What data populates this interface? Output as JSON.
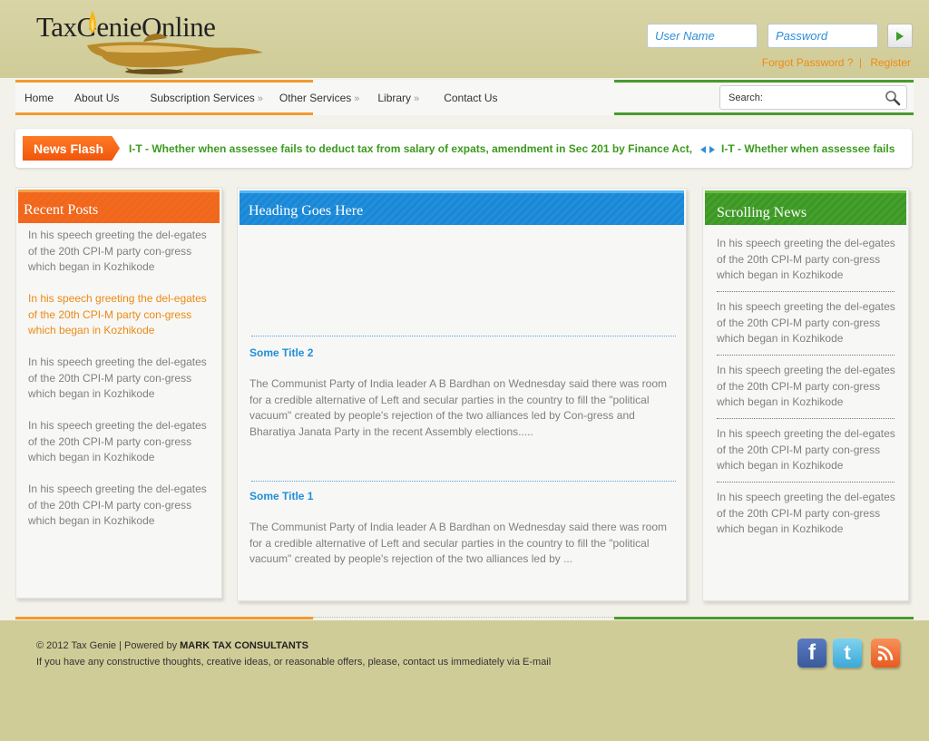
{
  "header": {
    "logo_text": "TaxGenieOnline",
    "user_placeholder": "User Name",
    "pass_placeholder": "Password",
    "forgot_link": "Forgot Password ?",
    "separator": "|",
    "register_link": "Register"
  },
  "nav": {
    "items": [
      {
        "label": "Home",
        "has_submenu": false
      },
      {
        "label": "About Us",
        "has_submenu": false
      },
      {
        "label": "Subscription Services",
        "has_submenu": true
      },
      {
        "label": "Other Services",
        "has_submenu": true
      },
      {
        "label": "Library",
        "has_submenu": true
      },
      {
        "label": "Contact Us",
        "has_submenu": false
      }
    ],
    "submenu_glyph": "»",
    "search_placeholder": "Search:"
  },
  "newsflash": {
    "badge": "News Flash",
    "text_1": "I-T - Whether when assessee fails to deduct tax from salary of expats, amendment in Sec 201 by Finance Act,",
    "text_2": "I-T - Whether when assessee fails"
  },
  "recent_posts": {
    "title": "Recent Posts",
    "items": [
      "In his speech greeting the del-egates of the 20th CPI-M party con-gress which began in Kozhikode",
      "In his speech greeting the del-egates of the 20th CPI-M party con-gress which began in Kozhikode",
      "In his speech greeting the del-egates of the 20th CPI-M party con-gress which began in Kozhikode",
      "In his speech greeting the del-egates of the 20th CPI-M party con-gress which began in Kozhikode",
      "In his speech greeting the del-egates of the 20th CPI-M party con-gress which began in Kozhikode"
    ]
  },
  "main": {
    "title": "Heading Goes Here",
    "items": [
      {
        "title": "Some Title 2",
        "body": "The Communist Party of India leader A B Bardhan on Wednesday said there was room for a credible alternative of Left and secular parties in the country to fill the \"political vacuum\" created by people's rejection of the two alliances led by Con-gress and Bharatiya Janata Party in the recent Assembly elections....."
      },
      {
        "title": "Some Title 1",
        "body": "The Communist Party of India leader A B Bardhan on Wednesday said there was room for a credible alternative of Left and secular parties in the country to fill the \"political vacuum\" created by people's rejection of the two alliances led by ..."
      }
    ]
  },
  "scrolling_news": {
    "title": "Scrolling News",
    "items": [
      "In his speech greeting the del-egates of the 20th CPI-M party con-gress which began in Kozhikode",
      "In his speech greeting the del-egates of the 20th CPI-M party con-gress which began in Kozhikode",
      "In his speech greeting the del-egates of the 20th CPI-M party con-gress which began in Kozhikode",
      "In his speech greeting the del-egates of the 20th CPI-M party con-gress which began in Kozhikode",
      "In his speech greeting the del-egates of the 20th CPI-M party con-gress which began in Kozhikode"
    ]
  },
  "footer": {
    "copyright": "© 2012 Tax Genie | Powered by",
    "powered_by": "MARK TAX CONSULTANTS",
    "line2": "If you have any constructive thoughts, creative ideas, or reasonable offers, please, contact us immediately via E-mail"
  },
  "social": {
    "icons": [
      "facebook-icon",
      "twitter-icon",
      "rss-icon"
    ]
  },
  "colors": {
    "header_bg": "#d0cc98",
    "accent_orange": "#f2661b",
    "accent_blue": "#1c86d4",
    "accent_green": "#3d9726",
    "news_text": "#3c9a1e",
    "link_orange": "#f08a14"
  }
}
